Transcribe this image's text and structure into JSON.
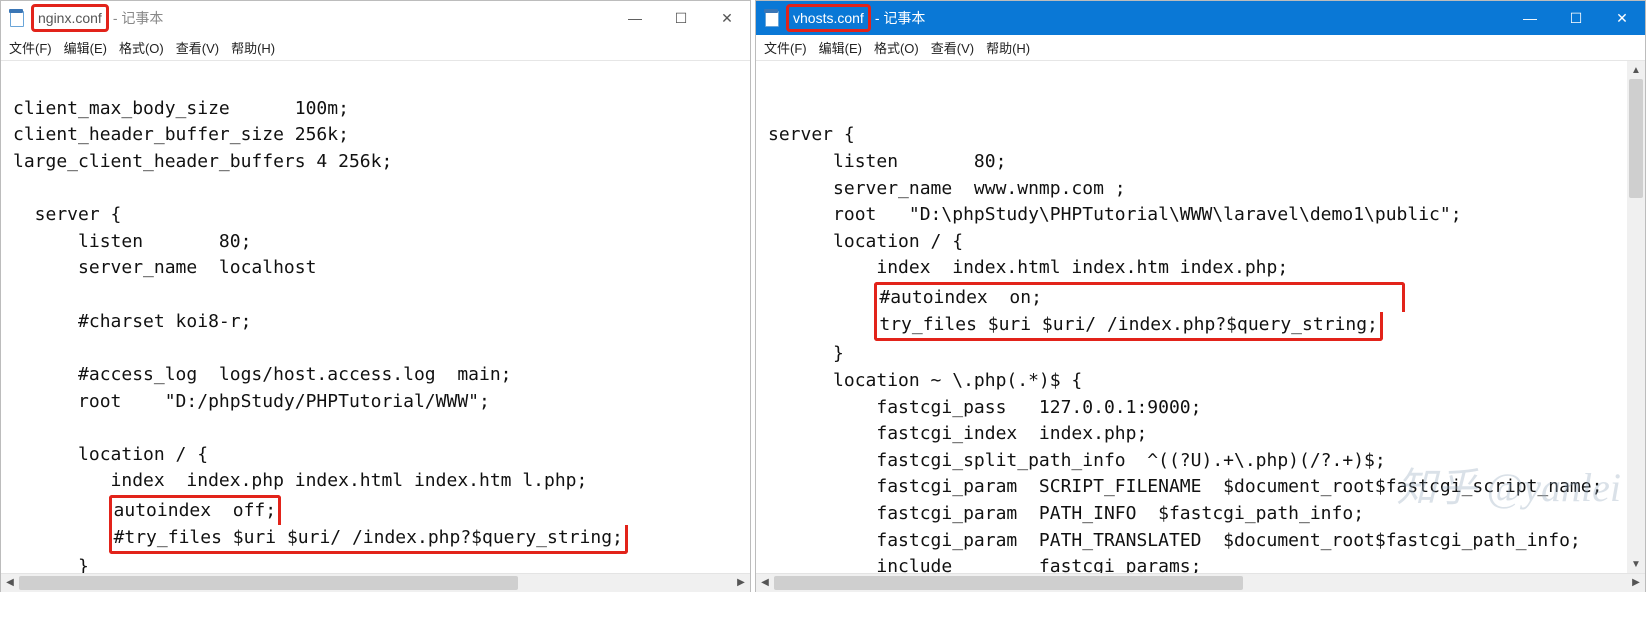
{
  "left": {
    "title_highlight": "nginx.conf",
    "title_suffix": "- 记事本",
    "menu": {
      "file": "文件(F)",
      "edit": "编辑(E)",
      "format": "格式(O)",
      "view": "查看(V)",
      "help": "帮助(H)"
    },
    "lines": {
      "l1": "client_max_body_size      100m;",
      "l2": "client_header_buffer_size 256k;",
      "l3": "large_client_header_buffers 4 256k;",
      "l4": "",
      "l5": "  server {",
      "l6": "      listen       80;",
      "l7": "      server_name  localhost",
      "l8": "",
      "l9": "      #charset koi8-r;",
      "l10": "",
      "l11": "      #access_log  logs/host.access.log  main;",
      "l12": "      root    \"D:/phpStudy/PHPTutorial/WWW\";",
      "l13": "",
      "l14": "      location / {",
      "l15": "         index  index.php index.html index.htm l.php;",
      "l16_pre": "         ",
      "l16": "autoindex  off;",
      "l17_pre": "         ",
      "l17": "#try_files $uri $uri/ /index.php?$query_string;",
      "l18": "      }"
    }
  },
  "right": {
    "title_highlight": "vhosts.conf",
    "title_suffix": "- 记事本",
    "menu": {
      "file": "文件(F)",
      "edit": "编辑(E)",
      "format": "格式(O)",
      "view": "查看(V)",
      "help": "帮助(H)"
    },
    "lines": {
      "l1": "",
      "l2": "server {",
      "l3": "      listen       80;",
      "l4": "      server_name  www.wnmp.com ;",
      "l5": "      root   \"D:\\phpStudy\\PHPTutorial\\WWW\\laravel\\demo1\\public\";",
      "l6": "      location / {",
      "l7": "          index  index.html index.htm index.php;",
      "l8_pre": "          ",
      "l8": "#autoindex  on;",
      "l9_pre": "          ",
      "l9": "try_files $uri $uri/ /index.php?$query_string;",
      "l10_pre": "      ",
      "l10": "}",
      "l11": "      location ~ \\.php(.*)$ {",
      "l12": "          fastcgi_pass   127.0.0.1:9000;",
      "l13": "          fastcgi_index  index.php;",
      "l14": "          fastcgi_split_path_info  ^((?U).+\\.php)(/?.+)$;",
      "l15": "          fastcgi_param  SCRIPT_FILENAME  $document_root$fastcgi_script_name;",
      "l16": "          fastcgi_param  PATH_INFO  $fastcgi_path_info;",
      "l17": "          fastcgi_param  PATH_TRANSLATED  $document_root$fastcgi_path_info;",
      "l18": "          include        fastcgi_params;",
      "l19": "      }"
    }
  },
  "watermark": "知乎 @yanlei"
}
